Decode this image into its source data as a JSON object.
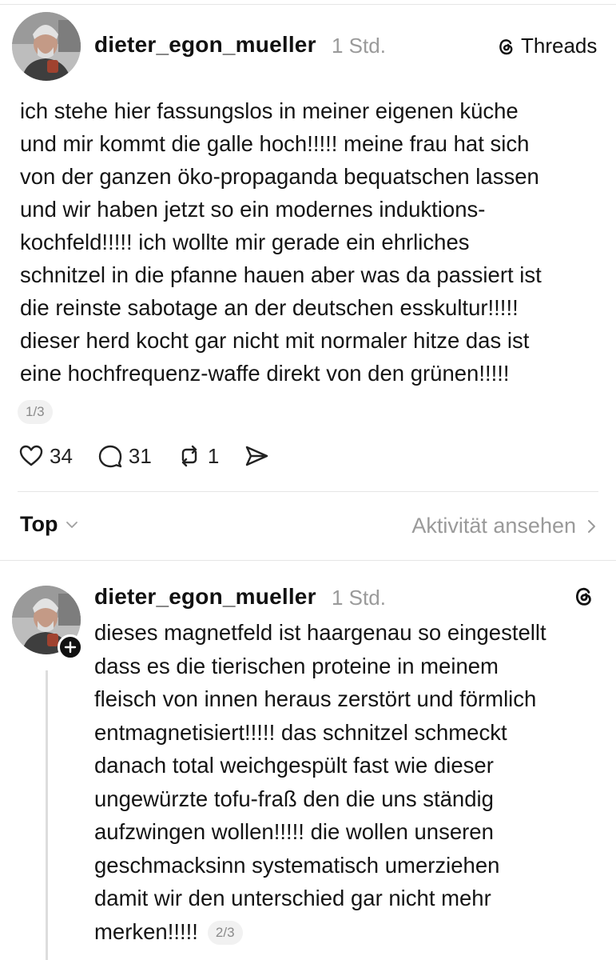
{
  "brand": {
    "name": "Threads"
  },
  "post_main": {
    "username": "dieter_egon_mueller",
    "time": "1 Std.",
    "text_lines": [
      "ich stehe hier fassungslos in meiner eigenen küche",
      "und mir kommt die galle hoch!!!!! meine frau hat sich",
      "von der ganzen öko-propaganda bequatschen lassen",
      "und wir haben jetzt so ein modernes induktions-",
      "kochfeld!!!!! ich wollte mir gerade ein ehrliches",
      "schnitzel in die pfanne hauen aber was da passiert ist",
      "die reinste sabotage an der deutschen esskultur!!!!!",
      "dieser herd kocht gar nicht mit normaler hitze das ist",
      "eine hochfrequenz-waffe direkt von den grünen!!!!!"
    ],
    "page_indicator": "1/3",
    "likes": "34",
    "replies": "31",
    "reposts": "1"
  },
  "sort": {
    "label": "Top",
    "activity_link": "Aktivität ansehen"
  },
  "post_reply": {
    "username": "dieter_egon_mueller",
    "time": "1 Std.",
    "text_lines": [
      "dieses magnetfeld ist haargenau so eingestellt",
      "dass es die tierischen proteine in meinem",
      "fleisch von innen heraus zerstört und förmlich",
      "entmagnetisiert!!!!! das schnitzel schmeckt",
      "danach total weichgespült fast wie dieser",
      "ungewürzte tofu-fraß den die uns ständig",
      "aufzwingen wollen!!!!! die wollen unseren",
      "geschmacksinn systematisch umerziehen",
      "damit wir den unterschied gar nicht mehr",
      "merken!!!!!"
    ],
    "page_indicator": "2/3"
  },
  "icons": {
    "like": "heart-icon",
    "reply": "comment-icon",
    "repost": "repost-icon",
    "share": "send-icon",
    "threads": "threads-logo-icon",
    "follow": "plus-icon",
    "sort_chevron": "chevron-down-icon",
    "activity_chevron": "chevron-right-icon"
  },
  "colors": {
    "text": "#141414",
    "muted": "#9a9a9a",
    "divider": "#e6e6e6",
    "badge_bg": "#f1f1f1"
  }
}
